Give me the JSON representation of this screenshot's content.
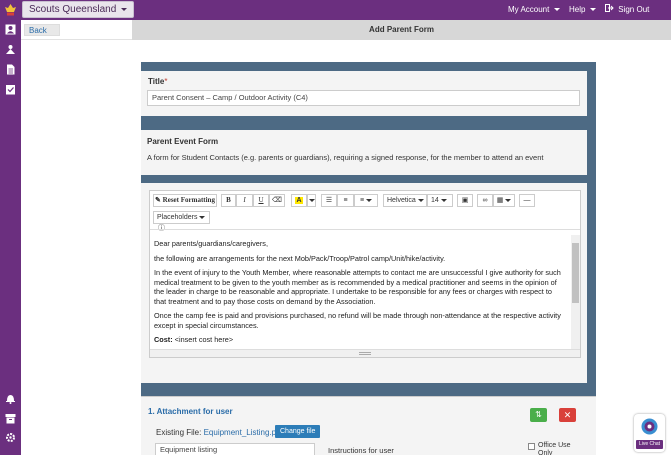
{
  "topbar": {
    "org_label": "Scouts Queensland",
    "my_account": "My Account",
    "help": "Help",
    "sign_out": "Sign Out"
  },
  "sidebar": {
    "icons": [
      "logo-icon",
      "contacts-icon",
      "tent-icon",
      "document-icon",
      "checklist-icon",
      "bell-icon",
      "archive-icon",
      "gear-icon"
    ]
  },
  "header": {
    "back_label": "Back",
    "page_title": "Add Parent Form"
  },
  "form": {
    "title_label": "Title",
    "title_required": "*",
    "title_value": "Parent Consent – Camp / Outdoor Activity (C4)",
    "event_form_label": "Parent Event Form",
    "event_form_description": "A form for Student Contacts (e.g. parents or guardians), requiring a signed response, for the member to attend an event"
  },
  "editor": {
    "toolbar": {
      "reset_formatting": "Reset Formatting",
      "bold": "B",
      "italic": "I",
      "underline": "U",
      "font_name": "Helvetica",
      "font_size": "14",
      "placeholders": "Placeholders"
    },
    "paragraphs": [
      "Dear parents/guardians/caregivers,",
      "the following are arrangements for the next Mob/Pack/Troop/Patrol camp/Unit/hike/activity.",
      "In the event of injury to the Youth Member, where reasonable attempts to contact me are unsuccessful I give authority for such medical treatment to be given to the youth member as is recommended by a medical practitioner and seems in the opinion of the leader in charge to be reasonable and appropriate. I undertake to be responsible for any fees or charges with respect to that treatment and to pay those costs on demand by the Association.",
      "Once the camp fee is paid and provisions purchased, no refund will be made through non-attendance at the respective activity except in special circumstances."
    ],
    "cost_label": "Cost:",
    "cost_value": " <insert cost here>"
  },
  "attachment": {
    "heading": "1. Attachment for user",
    "existing_file_label": "Existing File:",
    "existing_file_name": "Equipment_Listing.pdf",
    "change_file_label": "Change file",
    "name_value": "Equipment listing",
    "instructions_label": "Instructions for user",
    "office_use_label": "Office Use Only"
  },
  "livechat": {
    "label": "Live Chat"
  },
  "colors": {
    "brand_purple": "#6b2f7f",
    "slate": "#4d6a84",
    "link_blue": "#2a6ca8",
    "green": "#4aae4a",
    "red": "#d9403a"
  }
}
